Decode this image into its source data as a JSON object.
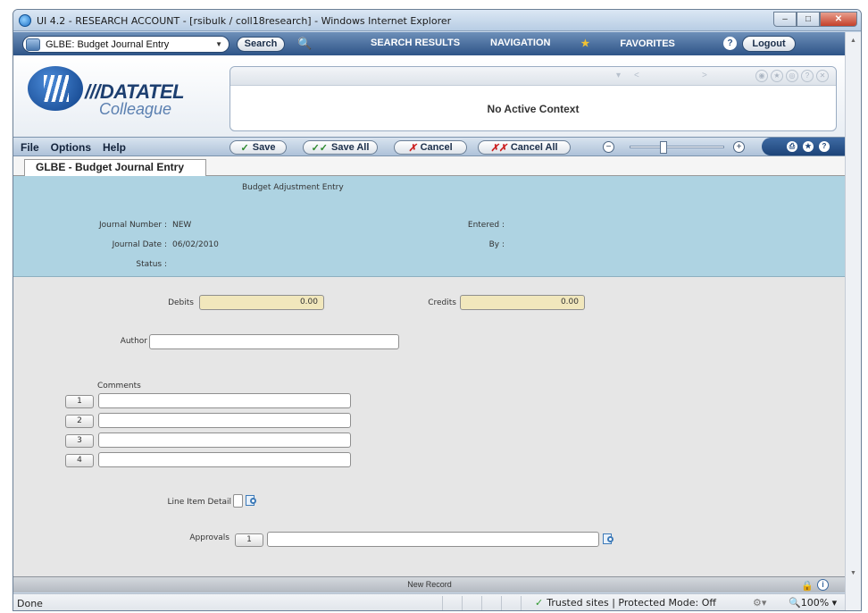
{
  "window": {
    "title": "UI 4.2 - RESEARCH ACCOUNT - [rsibulk / coll18research] - Windows Internet Explorer",
    "min": "–",
    "max": "□",
    "close": "✕"
  },
  "topbar": {
    "form_selector": "GLBE: Budget Journal Entry",
    "search_label": "Search",
    "nav": {
      "search_results": "SEARCH RESULTS",
      "navigation": "NAVIGATION",
      "favorites": "FAVORITES"
    },
    "help": "?",
    "logout": "Logout"
  },
  "logo": {
    "line1": "///DATATEL",
    "line2": "Colleague"
  },
  "context": {
    "text": "No Active Context"
  },
  "menu": [
    "File",
    "Options",
    "Help"
  ],
  "toolbar": {
    "save": "Save",
    "save_all": "Save All",
    "cancel": "Cancel",
    "cancel_all": "Cancel All",
    "zoom_minus": "−",
    "zoom_plus": "+"
  },
  "form": {
    "tab_label": "GLBE - Budget Journal Entry",
    "section_title": "Budget Adjustment Entry",
    "journal_number_label": "Journal Number :",
    "journal_number_value": "NEW",
    "journal_date_label": "Journal Date :",
    "journal_date_value": "06/02/2010",
    "status_label": "Status :",
    "status_value": "",
    "entered_label": "Entered :",
    "by_label": "By :",
    "debits_label": "Debits",
    "debits_value": "0.00",
    "credits_label": "Credits",
    "credits_value": "0.00",
    "author_label": "Author",
    "author_value": "",
    "comments_label": "Comments",
    "comments": [
      {
        "num": "1",
        "value": ""
      },
      {
        "num": "2",
        "value": ""
      },
      {
        "num": "3",
        "value": ""
      },
      {
        "num": "4",
        "value": ""
      }
    ],
    "line_item_label": "Line Item Detail",
    "approvals_label": "Approvals",
    "approvals_num": "1",
    "approvals_value": ""
  },
  "form_status": {
    "text": "New Record"
  },
  "ie_status": {
    "left": "Done",
    "zone": "Trusted sites | Protected Mode: Off",
    "zoom": "100%"
  }
}
